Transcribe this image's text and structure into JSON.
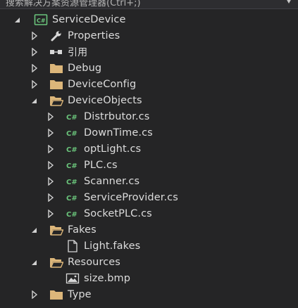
{
  "search": {
    "placeholder": "搜索解决方案资源管理器(Ctrl+;)"
  },
  "tree": {
    "project": {
      "label": "ServiceDevice",
      "icon": "csharp-project-icon"
    },
    "items": [
      {
        "label": "Properties",
        "icon": "wrench-icon",
        "expanded": false
      },
      {
        "label": "引用",
        "icon": "references-icon",
        "expanded": false
      },
      {
        "label": "Debug",
        "icon": "folder-icon",
        "expanded": false
      },
      {
        "label": "DeviceConfig",
        "icon": "folder-icon",
        "expanded": false
      },
      {
        "label": "DeviceObjects",
        "icon": "folder-open-icon",
        "expanded": true
      },
      {
        "label": "Distrbutor.cs",
        "icon": "csharp-file-icon",
        "expanded": false
      },
      {
        "label": "DownTime.cs",
        "icon": "csharp-file-icon",
        "expanded": false
      },
      {
        "label": "optLight.cs",
        "icon": "csharp-file-icon",
        "expanded": false
      },
      {
        "label": "PLC.cs",
        "icon": "csharp-file-icon",
        "expanded": false
      },
      {
        "label": "Scanner.cs",
        "icon": "csharp-file-icon",
        "expanded": false
      },
      {
        "label": "ServiceProvider.cs",
        "icon": "csharp-file-icon",
        "expanded": false
      },
      {
        "label": "SocketPLC.cs",
        "icon": "csharp-file-icon",
        "expanded": false
      },
      {
        "label": "Fakes",
        "icon": "folder-open-icon",
        "expanded": true
      },
      {
        "label": "Light.fakes",
        "icon": "file-icon"
      },
      {
        "label": "Resources",
        "icon": "folder-open-icon",
        "expanded": true
      },
      {
        "label": "size.bmp",
        "icon": "image-file-icon"
      },
      {
        "label": "Type",
        "icon": "folder-icon",
        "expanded": false
      }
    ]
  },
  "colors": {
    "background": "#252526",
    "text": "#dcdcdc",
    "folder": "#dcb67a",
    "csharp": "#6ac47b",
    "arrow": "#d0d0d0"
  }
}
